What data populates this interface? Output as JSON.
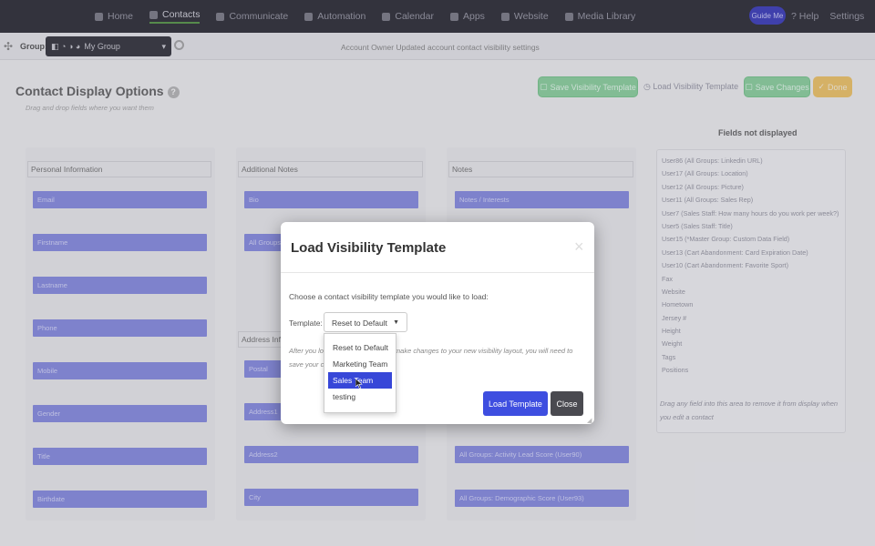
{
  "nav": {
    "items": [
      {
        "label": "Home",
        "icon": "home-icon"
      },
      {
        "label": "Contacts",
        "icon": "user-icon",
        "active": true
      },
      {
        "label": "Communicate",
        "icon": "mail-icon"
      },
      {
        "label": "Automation",
        "icon": "cog-icon"
      },
      {
        "label": "Calendar",
        "icon": "calendar-icon"
      },
      {
        "label": "Apps",
        "icon": "grid-icon"
      },
      {
        "label": "Website",
        "icon": "globe-icon"
      },
      {
        "label": "Media Library",
        "icon": "media-icon"
      }
    ],
    "guide": "Guide Me",
    "help": "? Help",
    "settings": "Settings"
  },
  "subbar": {
    "group_label": "Group:",
    "group_value": "My Group",
    "notice": "Account Owner Updated account contact visibility settings"
  },
  "header": {
    "title": "Contact Display Options",
    "subtitle": "Drag and drop fields where you want them",
    "save_template": "Save Visibility Template",
    "load_template": "Load Visibility Template",
    "save_changes": "Save Changes",
    "done": "Done"
  },
  "columns": {
    "personal": {
      "header": "Personal Information",
      "fields": [
        "Email",
        "Firstname",
        "Lastname",
        "Phone",
        "Mobile",
        "Gender",
        "Title",
        "Birthdate"
      ]
    },
    "notes": {
      "header": "Additional Notes",
      "fields": [
        "Bio",
        "All Groups"
      ]
    },
    "address": {
      "header": "Address Info",
      "fields": [
        "Postal",
        "Address1",
        "Address2",
        "City"
      ]
    },
    "notes2": {
      "header": "Notes",
      "fields": [
        "Notes / Interests",
        "All Groups: Activity Lead Score (User90)",
        "All Groups: Demographic Score (User93)"
      ]
    }
  },
  "not_displayed": {
    "title": "Fields not displayed",
    "items": [
      "User86 (All Groups: Linkedin URL)",
      "User17 (All Groups: Location)",
      "User12 (All Groups: Picture)",
      "User11 (All Groups: Sales Rep)",
      "User7 (Sales Staff: How many hours do you work per week?)",
      "User5 (Sales Staff: Title)",
      "User15 (*Master Group: Custom Data Field)",
      "User13 (Cart Abandonment: Card Expiration Date)",
      "User10 (Cart Abandonment: Favorite Sport)",
      "Fax",
      "Website",
      "Hometown",
      "Jersey #",
      "Height",
      "Weight",
      "Tags",
      "Positions"
    ],
    "help": "Drag any field into this area to remove it from display when you edit a contact"
  },
  "modal": {
    "title": "Load Visibility Template",
    "close": "×",
    "prompt": "Choose a contact visibility template you would like to load:",
    "template_label": "Template:",
    "selected": "Reset to Default",
    "note": "After you load a template you may make changes to your new visibility layout, you will need to save your changes.",
    "load_button": "Load Template",
    "close_button": "Close",
    "options": [
      "Reset to Default",
      "Marketing Team",
      "Sales Team",
      "testing"
    ],
    "highlighted_option": "Sales Team"
  },
  "colors": {
    "field": "#8a8fe6",
    "primary": "#3e4ee0",
    "green": "#8fd6a2",
    "yellow": "#f5c96a"
  }
}
